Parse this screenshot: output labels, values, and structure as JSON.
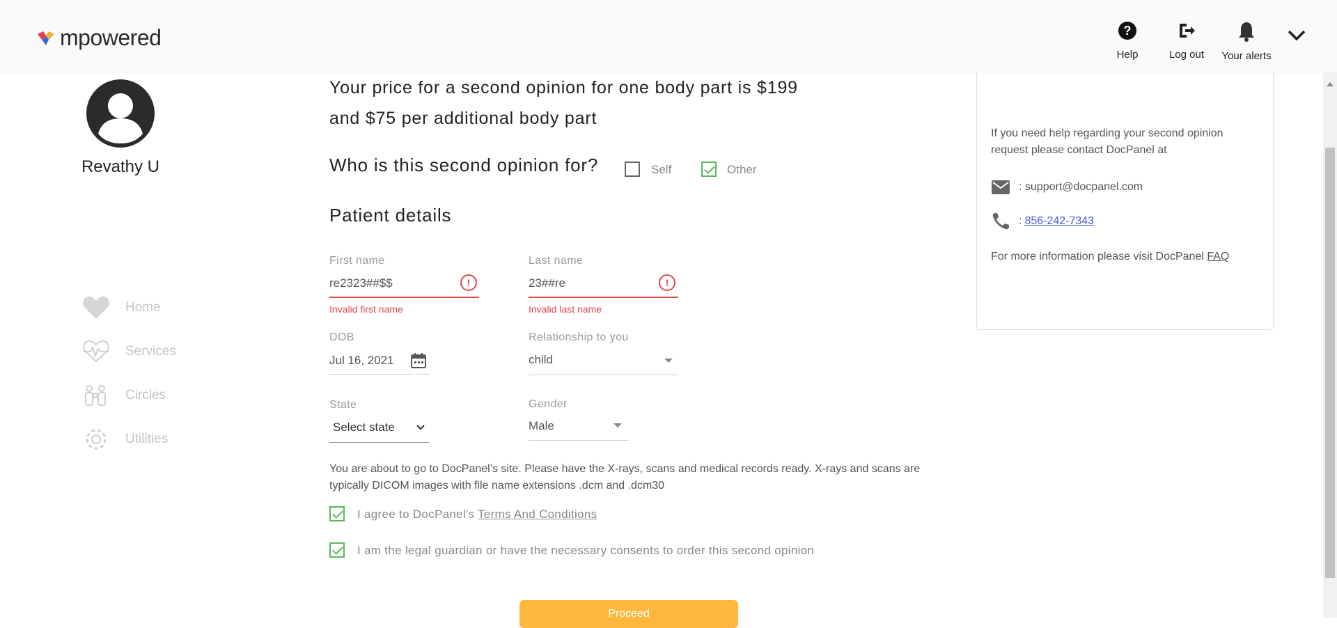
{
  "header": {
    "logo_text": "mpowered",
    "help_label": "Help",
    "logout_label": "Log out",
    "alerts_label": "Your alerts"
  },
  "profile": {
    "name": "Revathy U"
  },
  "nav": [
    {
      "label": "Home",
      "icon": "heart-icon"
    },
    {
      "label": "Services",
      "icon": "heartbeat-icon"
    },
    {
      "label": "Circles",
      "icon": "people-icon"
    },
    {
      "label": "Utilities",
      "icon": "gear-icon"
    }
  ],
  "main": {
    "price_line1": "Your price for a second opinion for one body part is $199",
    "price_line2": "and $75 per additional body part",
    "who_question": "Who is this second opinion for?",
    "self_label": "Self",
    "self_checked": false,
    "other_label": "Other",
    "other_checked": true,
    "section_title": "Patient details",
    "first_name": {
      "label": "First name",
      "value": "re2323##$$",
      "error": "Invalid first name"
    },
    "last_name": {
      "label": "Last name",
      "value": "23##re",
      "error": "Invalid last name"
    },
    "dob": {
      "label": "DOB",
      "value": "Jul 16, 2021"
    },
    "relationship": {
      "label": "Relationship to you",
      "value": "child"
    },
    "state": {
      "label": "State",
      "value": "Select state"
    },
    "gender": {
      "label": "Gender",
      "value": "Male"
    },
    "notice": "You are about to go to DocPanel’s site. Please have the X-rays, scans and medical records ready. X-rays and scans are typically DICOM images with file name extensions .dcm and .dcm30",
    "agree_prefix": "I agree to DocPanel's ",
    "agree_link": "Terms And Conditions",
    "guardian_text": "I am the legal guardian or have the necessary consents to order this second opinion",
    "proceed_label": "Proceed"
  },
  "helpbox": {
    "text": "If you need help regarding your second opinion request please contact DocPanel at",
    "email": ": support@docpanel.com",
    "phone_prefix": ": ",
    "phone": "856-242-7343",
    "more_prefix": "For more information please visit DocPanel ",
    "more_link": "FAQ"
  },
  "colors": {
    "accent": "#ffb83d",
    "error": "#e04848",
    "check": "#5cb85c"
  }
}
